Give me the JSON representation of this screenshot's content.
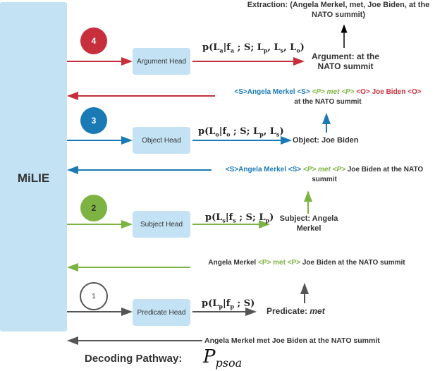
{
  "system": {
    "name": "MiLIE"
  },
  "steps": [
    {
      "number": "1",
      "head": "Predicate Head",
      "formula": "p(Lp|fp ; S)",
      "output_label": "Predicate:",
      "output_value": "met",
      "input_sentence": "Angela Merkel met Joe Biden at the NATO summit",
      "color": "#555555"
    },
    {
      "number": "2",
      "head": "Subject Head",
      "formula": "p(Ls|fs ; S; Lp)",
      "output_label": "Subject: Angela Merkel",
      "input_sentence": {
        "pre": "Angela Merkel ",
        "tag1": "<P> met <P>",
        "post": " Joe Biden at the NATO summit"
      },
      "color": "#7cb342"
    },
    {
      "number": "3",
      "head": "Object Head",
      "formula": "p(Lo|fo ; S; Lp, Ls)",
      "output_label": "Object: Joe Biden",
      "input_sentence": {
        "subj": "<S>Angela Merkel <S>",
        "pred_tag": "<P>",
        "pred": "met",
        "post": " Joe Biden at the NATO summit"
      },
      "color": "#1a7ab5"
    },
    {
      "number": "4",
      "head": "Argument Head",
      "formula": "p(La|fa ; S; Lp, Ls, Lo)",
      "output_label": "Argument: at the NATO summit",
      "input_sentence": {
        "subj": "<S>Angela Merkel <S>",
        "pred_tag": "<P>",
        "pred": "met",
        "obj": "<O> Joe Biden <O>",
        "post": "at the NATO summit"
      },
      "color": "#c62f3b"
    }
  ],
  "extraction": "Extraction: (Angela Merkel, met, Joe Biden, at the NATO summit)",
  "footer": {
    "label": "Decoding Pathway:",
    "symbol": "P",
    "subscript": "psoa"
  }
}
